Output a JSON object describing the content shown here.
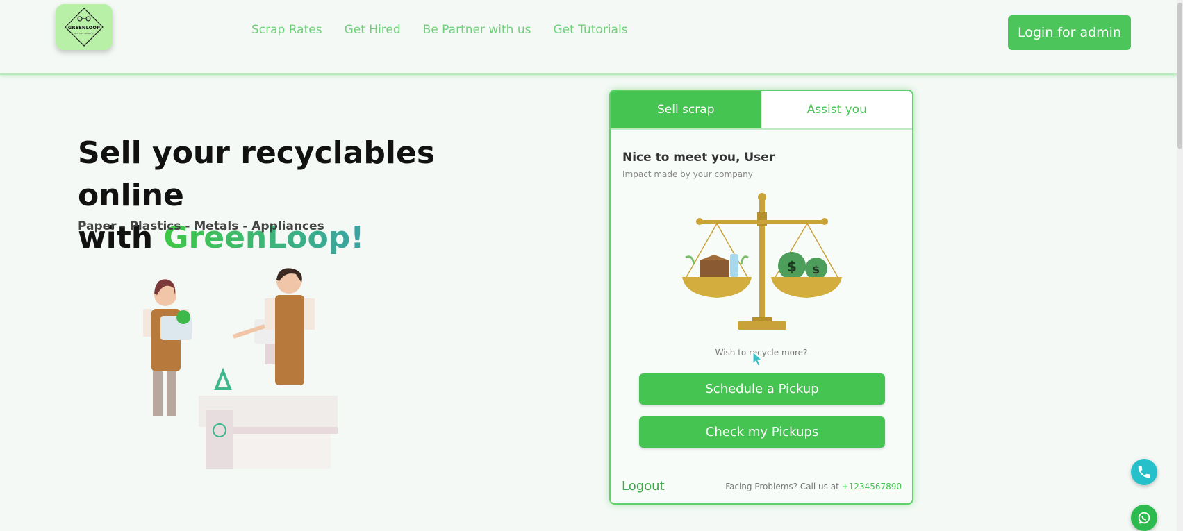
{
  "header": {
    "logo_text": "GREENLOOP",
    "logo_subtext": "RECYCLE SMARTLY",
    "nav": [
      {
        "label": "Scrap Rates"
      },
      {
        "label": "Get Hired"
      },
      {
        "label": "Be Partner with us"
      },
      {
        "label": "Get Tutorials"
      }
    ],
    "admin_button": "Login for admin"
  },
  "hero": {
    "title_line1": "Sell your recyclables online",
    "title_with": "with ",
    "brand": "GreenLoop!",
    "subtitle": "Paper - Plastics - Metals - Appliances"
  },
  "card": {
    "tabs": [
      {
        "label": "Sell scrap",
        "active": true
      },
      {
        "label": "Assist you",
        "active": false
      }
    ],
    "greeting": "Nice to meet you, User",
    "impact": "Impact made by your company",
    "wish": "Wish to recycle more?",
    "schedule_button": "Schedule a Pickup",
    "check_button": "Check my Pickups",
    "logout": "Logout",
    "facing_prefix": "Facing Problems? Call us at ",
    "phone": "+1234567890"
  },
  "icons": {
    "call": "phone-icon",
    "whatsapp": "whatsapp-icon"
  },
  "colors": {
    "accent": "#45c452",
    "nav": "#6fd07a",
    "brand_gradient_start": "#3fc845",
    "brand_gradient_end": "#3aa3a6",
    "call_fab": "#25c0c9",
    "whatsapp_fab": "#2dba4e"
  }
}
